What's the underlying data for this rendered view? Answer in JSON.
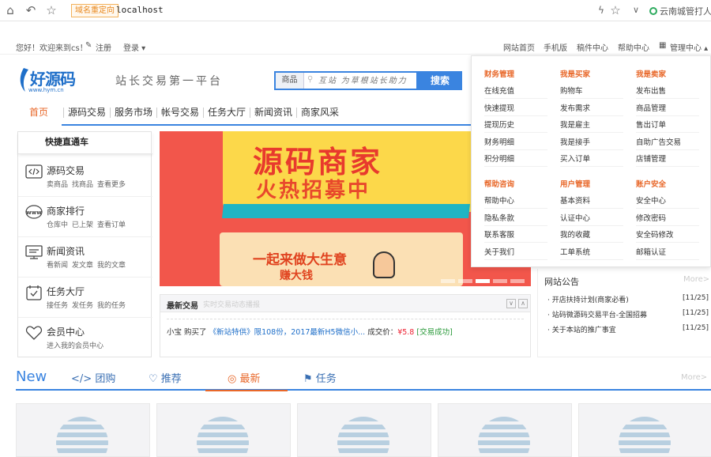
{
  "browser": {
    "site_tag": "域名重定向",
    "url": "localhost",
    "search_text": "云南城管打人"
  },
  "topnav": {
    "welcome": "您好！欢迎来到cs！",
    "register": "注册",
    "login": "登录",
    "links": [
      "网站首页",
      "手机版",
      "稿件中心",
      "帮助中心",
      "管理中心"
    ]
  },
  "header": {
    "logo_text": "好源码",
    "logo_url": "www.hym.cn",
    "slogan": "站长交易第一平台",
    "search_category": "商品",
    "search_placeholder": "互站 为草根站长助力",
    "search_button": "搜索"
  },
  "mainnav": [
    "首页",
    "源码交易",
    "服务市场",
    "帐号交易",
    "任务大厅",
    "新闻资讯",
    "商家风采"
  ],
  "quick_panel": {
    "title": "快捷直通车",
    "items": [
      {
        "name": "源码交易",
        "links": [
          "卖商品",
          "找商品",
          "查看更多"
        ],
        "icon": "code-icon"
      },
      {
        "name": "商家排行",
        "links": [
          "仓库中",
          "已上架",
          "查看订单"
        ],
        "icon": "www-icon"
      },
      {
        "name": "新闻资讯",
        "links": [
          "看新闻",
          "发文章",
          "我的文章"
        ],
        "icon": "monitor-icon"
      },
      {
        "name": "任务大厅",
        "links": [
          "接任务",
          "发任务",
          "我的任务"
        ],
        "icon": "calendar-check-icon"
      },
      {
        "name": "会员中心",
        "links": [
          "进入我的会员中心"
        ],
        "icon": "heart-icon"
      }
    ]
  },
  "banner": {
    "title": "源码商家",
    "subtitle": "火热招募中",
    "line1": "一起来做大生意",
    "line2": "赚大钱"
  },
  "trades": {
    "title": "最新交易",
    "subtitle": "实时交易动态播报",
    "row": {
      "user": "小宝",
      "action": "购买了",
      "item": "《新站特供》限108份，2017最新H5微信小...",
      "price_label": "成交价：",
      "price": "¥5.8",
      "status": "[交易成功]"
    }
  },
  "notice": {
    "title": "网站公告",
    "more": "More>",
    "items": [
      {
        "text": "· 开店扶持计划(商家必看)",
        "date": "[11/25]"
      },
      {
        "text": "· 站码微源码交易平台-全国招募",
        "date": "[11/25]"
      },
      {
        "text": "· 关于本站的推广事宜",
        "date": "[11/25]"
      }
    ]
  },
  "new_section": {
    "label": "New",
    "tabs": [
      "团购",
      "推荐",
      "最新",
      "任务"
    ],
    "active_tab": "最新",
    "more": "More>"
  },
  "dropdown": {
    "groups": [
      {
        "title": "财务管理",
        "items": [
          "在线充值",
          "快速提现",
          "提现历史",
          "财务明细",
          "积分明细"
        ]
      },
      {
        "title": "我是买家",
        "items": [
          "购物车",
          "发布需求",
          "我是雇主",
          "我是接手",
          "买入订单"
        ]
      },
      {
        "title": "我是卖家",
        "items": [
          "发布出售",
          "商品管理",
          "售出订单",
          "自助广告交易",
          "店铺管理"
        ]
      },
      {
        "title": "帮助咨询",
        "items": [
          "帮助中心",
          "隐私条款",
          "联系客服",
          "关于我们"
        ]
      },
      {
        "title": "用户管理",
        "items": [
          "基本资料",
          "认证中心",
          "我的收藏",
          "工单系统"
        ]
      },
      {
        "title": "账户安全",
        "items": [
          "安全中心",
          "修改密码",
          "安全码修改",
          "邮箱认证"
        ]
      }
    ]
  }
}
